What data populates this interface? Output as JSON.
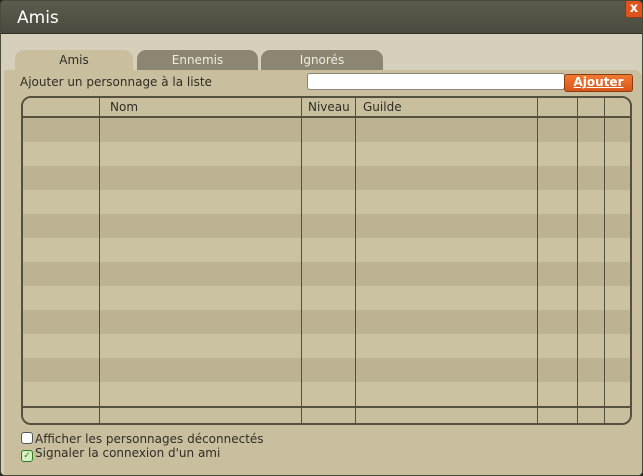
{
  "window": {
    "title": "Amis",
    "close_label": "x"
  },
  "tabs": [
    {
      "label": "Amis",
      "active": true
    },
    {
      "label": "Ennemis",
      "active": false
    },
    {
      "label": "Ignorés",
      "active": false
    }
  ],
  "add": {
    "label": "Ajouter un personnage à la liste",
    "input_value": "",
    "input_placeholder": "",
    "button_label": "Ajouter"
  },
  "table": {
    "columns": [
      "",
      "Nom",
      "Niveau",
      "Guilde",
      "",
      "",
      ""
    ],
    "rows": [],
    "visible_empty_rows": 12
  },
  "options": {
    "show_offline": {
      "label": "Afficher les personnages déconnectés",
      "checked": false
    },
    "notify_login": {
      "label": "Signaler la connexion d'un ami",
      "checked": true
    }
  },
  "colors": {
    "accent_button": "#e0621e",
    "panel": "#c9bf9f",
    "titlebar": "#4f4f42"
  }
}
